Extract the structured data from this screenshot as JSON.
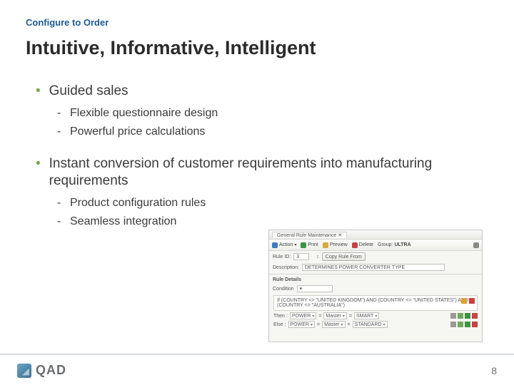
{
  "kicker": "Configure to Order",
  "title": "Intuitive, Informative, Intelligent",
  "bullets": [
    {
      "text": "Guided sales",
      "sub": [
        "Flexible questionnaire design",
        "Powerful price calculations"
      ]
    },
    {
      "text": "Instant conversion of customer requirements into manufacturing requirements",
      "sub": [
        "Product configuration rules",
        "Seamless integration"
      ]
    }
  ],
  "app": {
    "tab": "General Rule Maintenance",
    "toolbar": {
      "action": "Action",
      "print": "Print",
      "preview": "Preview",
      "delete": "Delete",
      "group_label": "Group:",
      "group_value": "ULTRA"
    },
    "rule": {
      "rule_label": "Rule ID:",
      "rule_value": "3",
      "copy_btn": "Copy Rule From",
      "desc_label": "Description:",
      "desc_value": "DETERMINES POWER CONVERTER TYPE",
      "section_label": "Rule Details",
      "cond_label": "Condition",
      "cond_text": "If (COUNTRY <> \"UNITED KINGDOM\") AND (COUNTRY <> \"UNITED STATES\") AND (COUNTRY <> \"AUSTRALIA\")"
    },
    "then": {
      "label": "Then :",
      "c1": "POWER",
      "c2": "Master",
      "c3": "SMART"
    },
    "else": {
      "label": "Else :",
      "c1": "POWER",
      "c2": "Master",
      "c3": "STANDARD"
    }
  },
  "logo_text": "QAD",
  "page_number": "8"
}
